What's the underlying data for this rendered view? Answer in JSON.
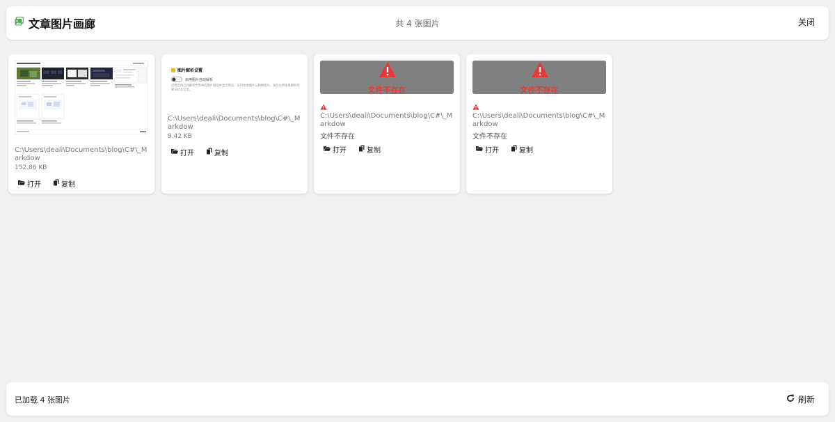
{
  "header": {
    "title": "文章图片画廊",
    "count_text": "共 4 张图片",
    "close_label": "关闭"
  },
  "cards": [
    {
      "path": "C:\\Users\\deali\\Documents\\blog\\C#\\_Markdow",
      "meta": "152.86 KB",
      "open_label": "打开",
      "copy_label": "复制"
    },
    {
      "path": "C:\\Users\\deali\\Documents\\blog\\C#\\_Markdow",
      "meta": "9.42 KB",
      "open_label": "打开",
      "copy_label": "复制",
      "thumb_title": "图片解析设置",
      "thumb_toggle_label": "启用图片自动解析",
      "thumb_desc": "启用后将自动解析文章中的图片链接并显示预览，支持本地图片与网络图片，请在右侧查看解析结果与状态信息。"
    },
    {
      "missing_text": "文件不存在",
      "path": "C:\\Users\\deali\\Documents\\blog\\C#\\_Markdow",
      "meta": "文件不存在",
      "open_label": "打开",
      "copy_label": "复制"
    },
    {
      "missing_text": "文件不存在",
      "path": "C:\\Users\\deali\\Documents\\blog\\C#\\_Markdow",
      "meta": "文件不存在",
      "open_label": "打开",
      "copy_label": "复制"
    }
  ],
  "footer": {
    "status": "已加载 4 张图片",
    "refresh_label": "刷新"
  },
  "colors": {
    "title_icon": "#4caf50",
    "warning": "#e53935",
    "missing_bg": "#808080",
    "page_bg": "#f1f1f1"
  },
  "icons": {
    "title": "gallery-image-icon",
    "open": "folder-open-icon",
    "copy": "copy-icon",
    "warning": "warning-triangle-icon",
    "refresh": "refresh-icon"
  }
}
